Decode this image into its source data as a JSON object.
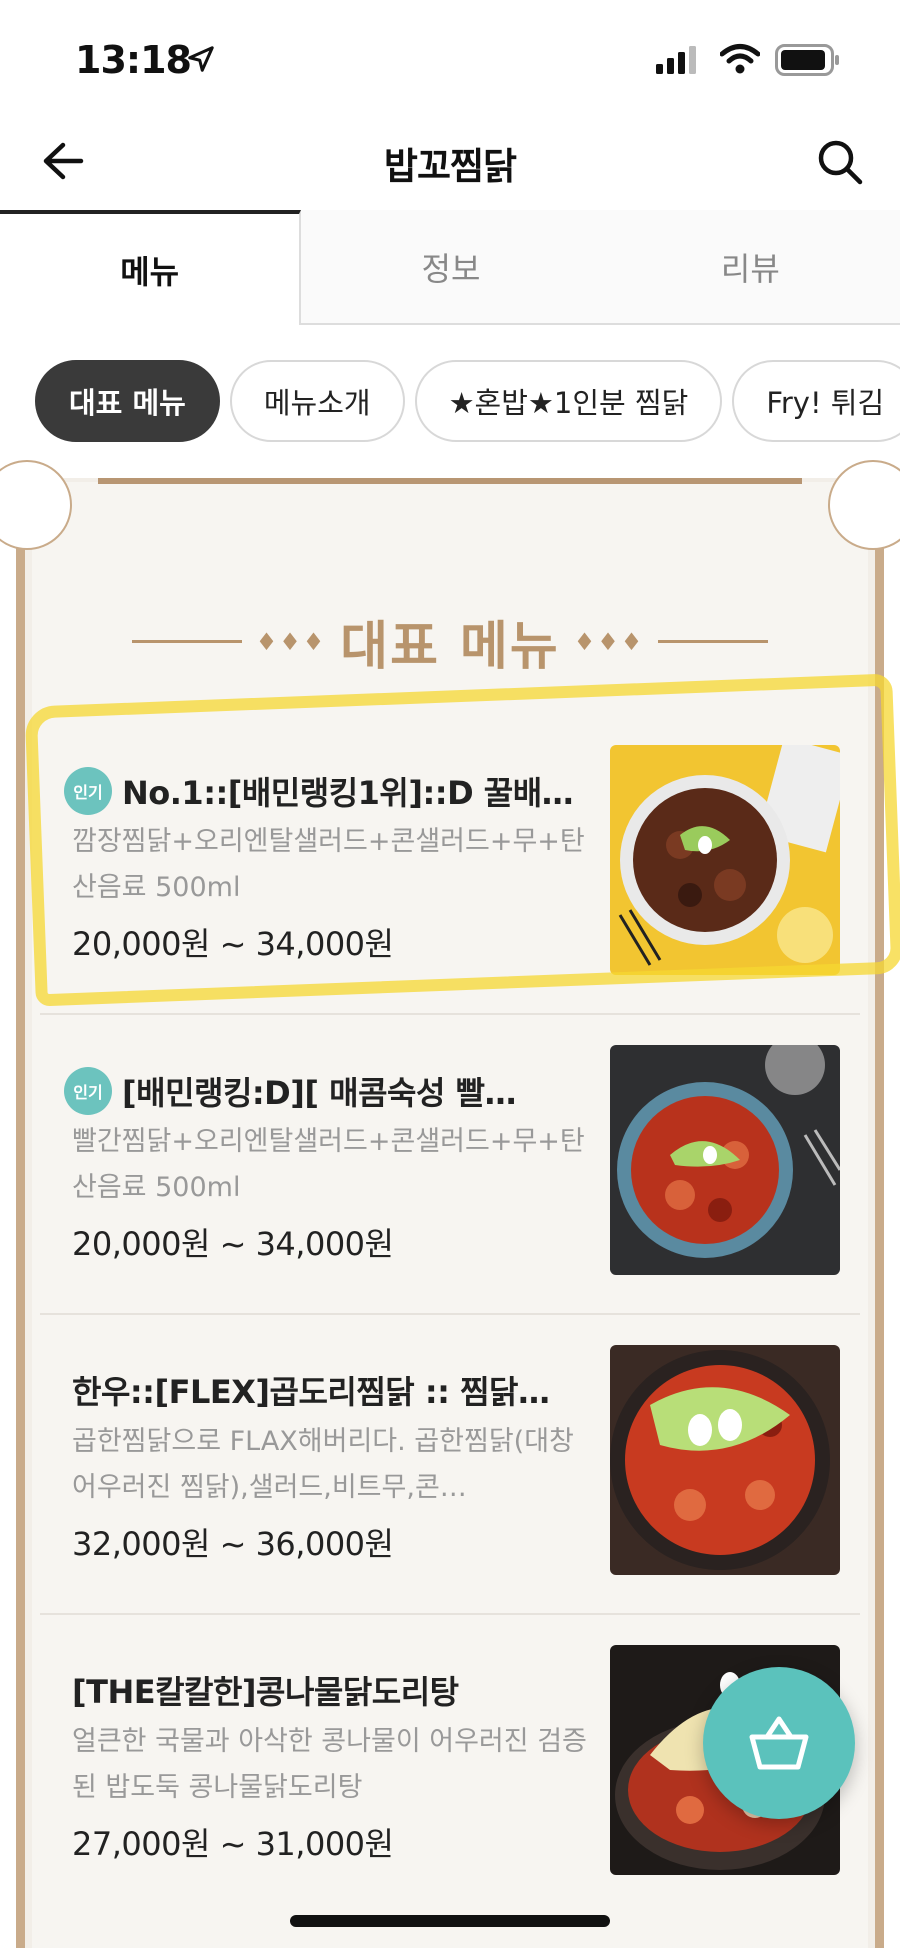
{
  "status_bar": {
    "time": "13:18"
  },
  "header": {
    "title": "밥꼬찜닭",
    "back_icon": "arrow-left",
    "search_icon": "search"
  },
  "tabs": [
    {
      "label": "메뉴",
      "active": true
    },
    {
      "label": "정보",
      "active": false
    },
    {
      "label": "리뷰",
      "active": false
    }
  ],
  "chips": [
    {
      "label": "대표 메뉴",
      "active": true
    },
    {
      "label": "메뉴소개",
      "active": false
    },
    {
      "label": "★혼밥★1인분 찜닭",
      "active": false
    },
    {
      "label": "Fry! 튀김",
      "active": false
    }
  ],
  "section": {
    "title": "대표 메뉴",
    "ornament": "♦♦♦"
  },
  "menu_items": [
    {
      "badge": "인기",
      "name": "No.1::[배민랭킹1위]::D 꿀배…",
      "description": "깜장찜닭+오리엔탈샐러드+콘샐러드+무+탄산음료 500ml",
      "price": "20,000원 ~ 34,000원"
    },
    {
      "badge": "인기",
      "name": "[배민랭킹:D][ 매콤숙성 빨…",
      "description": "빨간찜닭+오리엔탈샐러드+콘샐러드+무+탄산음료 500ml",
      "price": "20,000원 ~ 34,000원"
    },
    {
      "badge": "",
      "name": "한우::[FLEX]곱도리찜닭 :: 찜닭…",
      "description": "곱한찜닭으로 FLAX해버리다. 곱한찜닭(대창 어우러진 찜닭),샐러드,비트무,콘…",
      "price": "32,000원 ~ 36,000원"
    },
    {
      "badge": "",
      "name": "[THE칼칼한]콩나물닭도리탕",
      "description": "얼큰한 국물과 아삭한 콩나물이 어우러진 검증된 밥도둑 콩나물닭도리탕",
      "price": "27,000원 ~ 31,000원"
    }
  ],
  "colors": {
    "accent_teal": "#5bc2bc",
    "frame_gold": "#c9ab8a",
    "highlight_yellow": "#f5d732",
    "chip_active": "#3a3a3a"
  },
  "cart_icon": "basket"
}
